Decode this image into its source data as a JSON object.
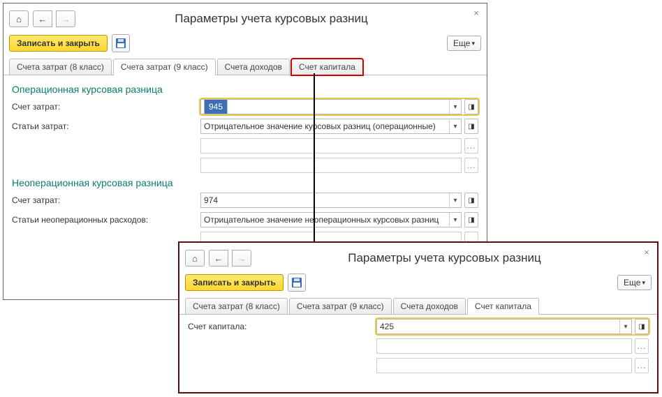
{
  "win1": {
    "title": "Параметры учета курсовых разниц",
    "toolbar": {
      "save_close": "Записать и закрыть",
      "more": "Еще"
    },
    "tabs": [
      "Счета затрат (8 класс)",
      "Счета затрат (9 класс)",
      "Счета доходов",
      "Счет капитала"
    ],
    "active_tab": 1,
    "marked_tab": 3,
    "section1": "Операционная курсовая разница",
    "section2": "Неоперационная курсовая разница",
    "labels": {
      "expense_acct": "Счет затрат:",
      "expense_items": "Статьи затрат:",
      "nonop_expense_items": "Статьи неоперационных расходов:"
    },
    "values": {
      "op_acct": "945",
      "op_item": "Отрицательное значение курсовых разниц (операционные)",
      "nonop_acct": "974",
      "nonop_item": "Отрицательное значение неоперационных курсовых разниц"
    }
  },
  "win2": {
    "title": "Параметры учета курсовых разниц",
    "toolbar": {
      "save_close": "Записать и закрыть",
      "more": "Еще"
    },
    "tabs": [
      "Счета затрат (8 класс)",
      "Счета затрат (9 класс)",
      "Счета доходов",
      "Счет капитала"
    ],
    "active_tab": 3,
    "labels": {
      "capital_acct": "Счет капитала:"
    },
    "values": {
      "capital_acct": "425"
    }
  },
  "icons": {
    "home": "⌂",
    "back": "←",
    "fwd": "→",
    "caret": "▾",
    "open": "◨",
    "dots": "...",
    "close": "×"
  }
}
